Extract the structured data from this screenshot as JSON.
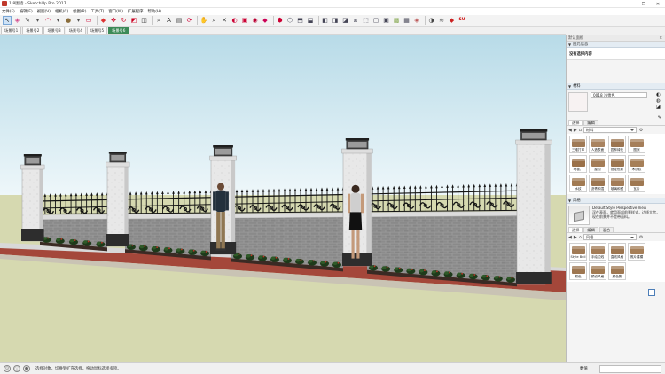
{
  "title": "1.8围墙 - SketchUp Pro 2017",
  "menu": [
    "文件(F)",
    "编辑(E)",
    "视图(V)",
    "相机(C)",
    "绘图(R)",
    "工具(T)",
    "窗口(W)",
    "扩展程序",
    "帮助(H)"
  ],
  "window_controls": [
    "—",
    "❐",
    "✕"
  ],
  "toolbar_icons": [
    {
      "name": "select-arrow-icon",
      "glyph": "↖",
      "color": "#222"
    },
    {
      "name": "eraser-icon",
      "glyph": "◈",
      "color": "#d24a8c"
    },
    {
      "name": "pencil-line-icon",
      "glyph": "✎",
      "color": "#333"
    },
    {
      "name": "dropdown-caret-icon",
      "glyph": "▾",
      "color": "#555"
    },
    {
      "name": "arc-icon",
      "glyph": "◠",
      "color": "#c03"
    },
    {
      "name": "dropdown-caret-icon",
      "glyph": "▾",
      "color": "#555"
    },
    {
      "name": "paint-bucket-icon",
      "glyph": "●",
      "color": "#8a6d3b"
    },
    {
      "name": "dropdown-caret-icon",
      "glyph": "▾",
      "color": "#555"
    },
    {
      "name": "rectangle-icon",
      "glyph": "▭",
      "color": "#c03"
    },
    {
      "name": "push-pull-icon",
      "glyph": "◆",
      "color": "#d33"
    },
    {
      "name": "move-icon",
      "glyph": "✥",
      "color": "#c02"
    },
    {
      "name": "rotate-icon",
      "glyph": "↻",
      "color": "#c02"
    },
    {
      "name": "scale-icon",
      "glyph": "◩",
      "color": "#c02"
    },
    {
      "name": "offset-icon",
      "glyph": "◫",
      "color": "#333"
    },
    {
      "name": "tape-measure-icon",
      "glyph": "⌕",
      "color": "#444"
    },
    {
      "name": "text-icon",
      "glyph": "A",
      "color": "#333"
    },
    {
      "name": "paint-icon",
      "glyph": "▤",
      "color": "#444"
    },
    {
      "name": "orbit-icon",
      "glyph": "⟳",
      "color": "#c03"
    },
    {
      "name": "pan-hand-icon",
      "glyph": "✋",
      "color": "#c07"
    },
    {
      "name": "zoom-icon",
      "glyph": "⌕",
      "color": "#333"
    },
    {
      "name": "zoom-extents-icon",
      "glyph": "✕",
      "color": "#333"
    },
    {
      "name": "section-plane-icon",
      "glyph": "◐",
      "color": "#c03"
    },
    {
      "name": "warehouse-icon",
      "glyph": "▣",
      "color": "#c03"
    },
    {
      "name": "extension-icon",
      "glyph": "◉",
      "color": "#b03"
    },
    {
      "name": "sandbox-icon",
      "glyph": "◆",
      "color": "#c05"
    },
    {
      "name": "layout-icon",
      "glyph": "⬢",
      "color": "#c03"
    },
    {
      "name": "iso-view-icon",
      "glyph": "⬡",
      "color": "#445"
    },
    {
      "name": "top-view-icon",
      "glyph": "⬒",
      "color": "#445"
    },
    {
      "name": "front-view-icon",
      "glyph": "⬓",
      "color": "#445"
    },
    {
      "name": "right-view-icon",
      "glyph": "◧",
      "color": "#445"
    },
    {
      "name": "back-view-icon",
      "glyph": "◨",
      "color": "#445"
    },
    {
      "name": "left-view-icon",
      "glyph": "◪",
      "color": "#445"
    },
    {
      "name": "xray-icon",
      "glyph": "⧈",
      "color": "#445"
    },
    {
      "name": "wireframe-icon",
      "glyph": "⬚",
      "color": "#445"
    },
    {
      "name": "hidden-line-icon",
      "glyph": "▢",
      "color": "#445"
    },
    {
      "name": "shaded-icon",
      "glyph": "▣",
      "color": "#445"
    },
    {
      "name": "textured-icon",
      "glyph": "▩",
      "color": "#8a5"
    },
    {
      "name": "monochrome-icon",
      "glyph": "▦",
      "color": "#445"
    },
    {
      "name": "style-builder-icon",
      "glyph": "◈",
      "color": "#b55"
    },
    {
      "name": "shadow-icon",
      "glyph": "◑",
      "color": "#444"
    },
    {
      "name": "fog-icon",
      "glyph": "≋",
      "color": "#444"
    },
    {
      "name": "plugin-ruby-icon",
      "glyph": "◆",
      "color": "#c22"
    },
    {
      "name": "plugin-su-icon",
      "glyph": "SU",
      "color": "#c00"
    }
  ],
  "scene_tabs": [
    "场景号1",
    "场景号2",
    "场景号3",
    "场景号4",
    "场景号5",
    "场景号6"
  ],
  "active_scene_index": 5,
  "tray": {
    "header": "默认面板",
    "entity_info": {
      "title": "图元信息",
      "value": "没有选择内容"
    },
    "materials": {
      "title": "材料",
      "current_name": "0018 浅雪色",
      "tabs": [
        "选择",
        "编辑"
      ],
      "library": "材料",
      "items": [
        {
          "label": "三维打印",
          "color": "#a07a55"
        },
        {
          "label": "人造表面",
          "color": "#a9835f"
        },
        {
          "label": "园林绿化",
          "color": "#9b7450"
        },
        {
          "label": "图案",
          "color": "#a57e59"
        },
        {
          "label": "地毯、",
          "color": "#9a7048"
        },
        {
          "label": "屋顶",
          "color": "#a47c56"
        },
        {
          "label": "指定色彩",
          "color": "#9c754f"
        },
        {
          "label": "木质纹",
          "color": "#a67f58"
        },
        {
          "label": "水纹",
          "color": "#a17a52"
        },
        {
          "label": "沥青和混",
          "color": "#9d7650"
        },
        {
          "label": "玻璃和镜",
          "color": "#a37c57"
        },
        {
          "label": "瓦片",
          "color": "#9f7852"
        }
      ]
    },
    "styles": {
      "title": "风格",
      "current_name": "Default Style Perspective View",
      "description": "浮在表面，就用面部前景样式，边线大宫，现在前景并不是带面料。",
      "tabs": [
        "选择",
        "编辑",
        "混合"
      ],
      "library": "风格",
      "items": [
        {
          "label": "Style Buil",
          "color": "#a07a55"
        },
        {
          "label": "手绘边线",
          "color": "#a37c57"
        },
        {
          "label": "直线风格",
          "color": "#9c754f"
        },
        {
          "label": "照片建模",
          "color": "#a67f58"
        },
        {
          "label": "颜色",
          "color": "#9d7650"
        },
        {
          "label": "预设风格",
          "color": "#a17a52"
        },
        {
          "label": "颜色集",
          "color": "#9f7852"
        }
      ]
    }
  },
  "status": {
    "message": "选择对象。切换到扩充选择。拖动鼠标选择多项。",
    "measure_label": "数值",
    "measure_value": ""
  },
  "scene": {
    "ground_color": "#d6d9b0",
    "sky_top": "#b8dbe8",
    "sky_bottom": "#eef7fa",
    "railing_color": "#151515",
    "pillar_color": "#f1f1f1"
  }
}
